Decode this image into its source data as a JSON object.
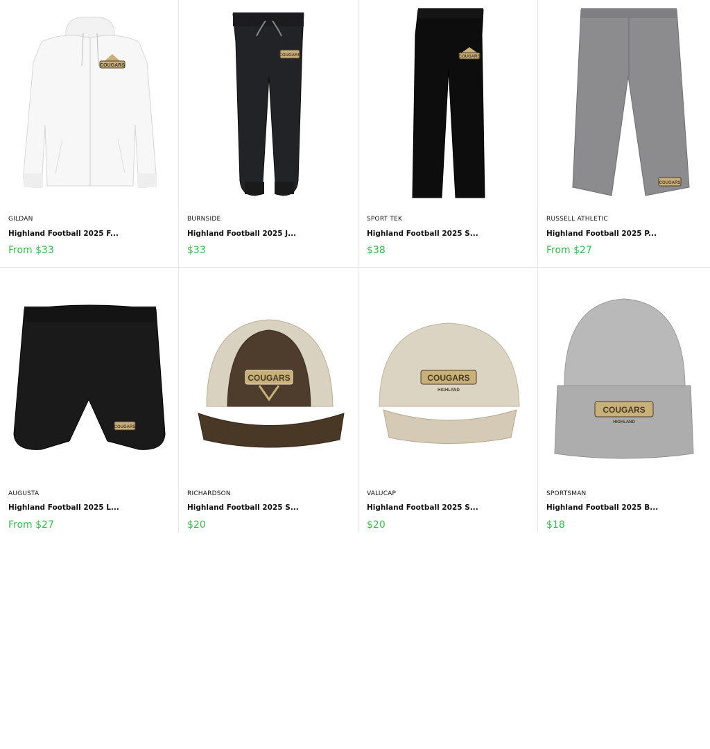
{
  "products": [
    {
      "brand": "GILDAN",
      "title": "Highland Football 2025 F...",
      "price": "From $33",
      "image": "white-zip-hoodie"
    },
    {
      "brand": "BURNSIDE",
      "title": "Highland Football 2025 J...",
      "price": "$33",
      "image": "black-joggers"
    },
    {
      "brand": "SPORT TEK",
      "title": "Highland Football 2025 S...",
      "price": "$38",
      "image": "black-sweatpants"
    },
    {
      "brand": "RUSSELL ATHLETIC",
      "title": "Highland Football 2025 P...",
      "price": "From $27",
      "image": "gray-shorts"
    },
    {
      "brand": "AUGUSTA",
      "title": "Highland Football 2025 L...",
      "price": "From $27",
      "image": "black-running-shorts"
    },
    {
      "brand": "RICHARDSON",
      "title": "Highland Football 2025 S...",
      "price": "$20",
      "image": "brown-trucker-cap"
    },
    {
      "brand": "VALUCAP",
      "title": "Highland Football 2025 S...",
      "price": "$20",
      "image": "khaki-dad-cap"
    },
    {
      "brand": "SPORTSMAN",
      "title": "Highland Football 2025 B...",
      "price": "$18",
      "image": "gray-beanie"
    }
  ],
  "logos": {
    "team_name": "COUGARS",
    "school_name": "HIGHLAND"
  },
  "colors": {
    "price": "#3cb551",
    "border": "#e6e6e6",
    "logo_gold": "#c8b07a",
    "logo_brown": "#4a3a28"
  }
}
